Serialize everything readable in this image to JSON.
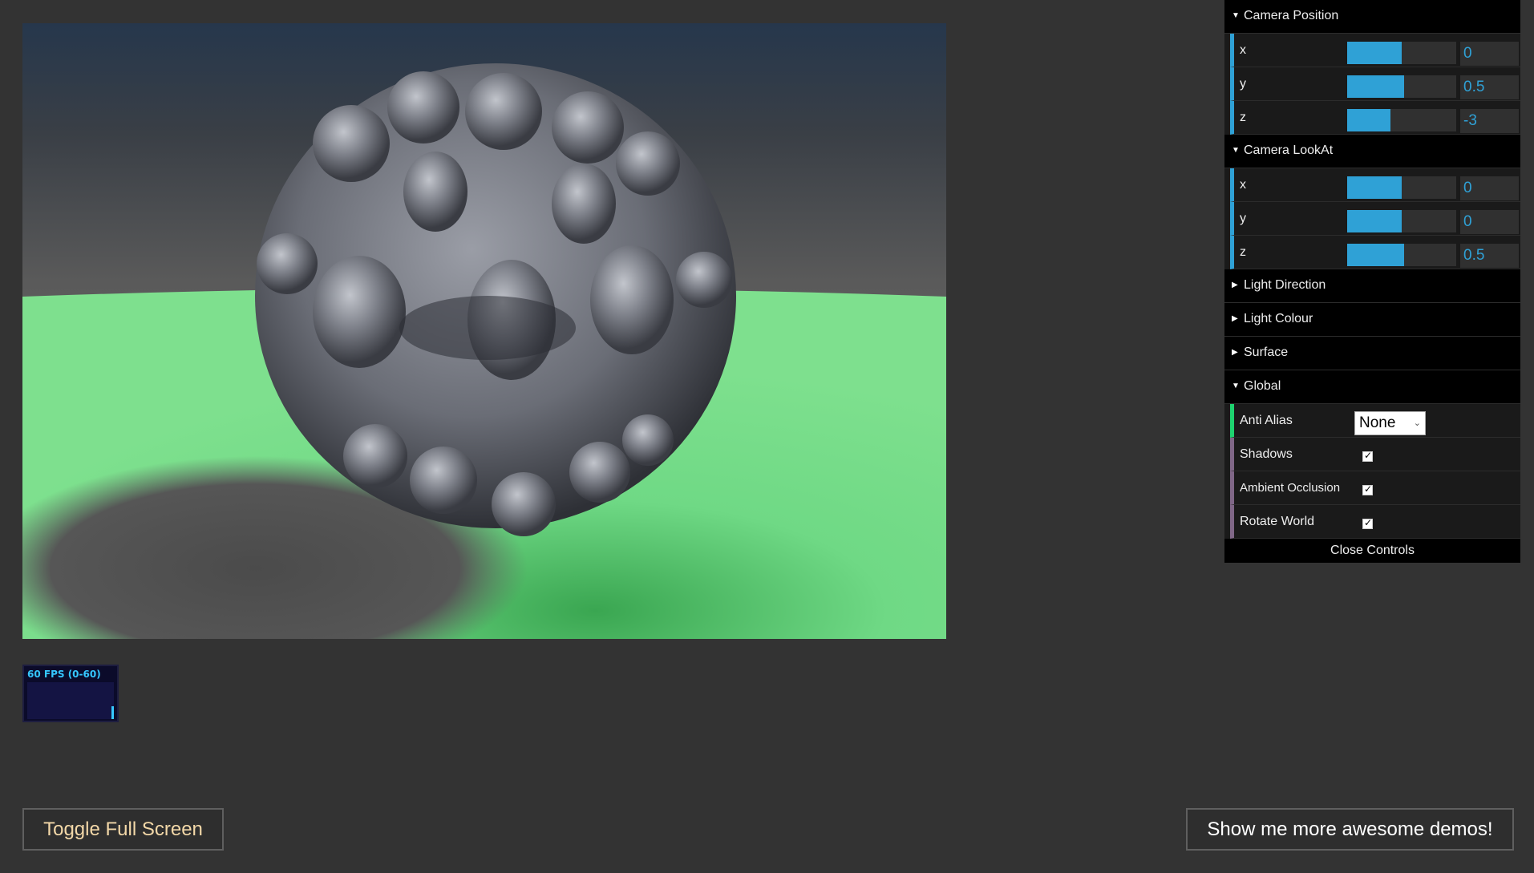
{
  "fps": {
    "label": "60 FPS (0-60)",
    "level": 0.35
  },
  "buttons": {
    "toggle_fullscreen": "Toggle Full Screen",
    "more_demos": "Show me more awesome demos!"
  },
  "controls": {
    "camera_position": {
      "title": "Camera Position",
      "expanded": true,
      "x": {
        "label": "x",
        "value": "0",
        "fill": 0.5
      },
      "y": {
        "label": "y",
        "value": "0.5",
        "fill": 0.52
      },
      "z": {
        "label": "z",
        "value": "-3",
        "fill": 0.4
      }
    },
    "camera_lookat": {
      "title": "Camera LookAt",
      "expanded": true,
      "x": {
        "label": "x",
        "value": "0",
        "fill": 0.5
      },
      "y": {
        "label": "y",
        "value": "0",
        "fill": 0.5
      },
      "z": {
        "label": "z",
        "value": "0.5",
        "fill": 0.52
      }
    },
    "light_direction": {
      "title": "Light Direction",
      "expanded": false
    },
    "light_colour": {
      "title": "Light Colour",
      "expanded": false
    },
    "surface": {
      "title": "Surface",
      "expanded": false
    },
    "global": {
      "title": "Global",
      "expanded": true,
      "anti_alias": {
        "label": "Anti Alias",
        "value": "None"
      },
      "shadows": {
        "label": "Shadows",
        "checked": true
      },
      "ambient_occlusion": {
        "label": "Ambient Occlusion",
        "checked": true
      },
      "rotate_world": {
        "label": "Rotate World",
        "checked": true
      }
    },
    "close_label": "Close Controls"
  },
  "colors": {
    "background": "#333333",
    "accent_slider": "#2fa1d6",
    "ground": "#7ee08e",
    "fractal": "#6a6d76"
  },
  "icons": {
    "expanded": "caret-down-icon",
    "collapsed": "caret-right-icon",
    "check": "checkmark-icon",
    "select": "chevron-down-icon"
  }
}
